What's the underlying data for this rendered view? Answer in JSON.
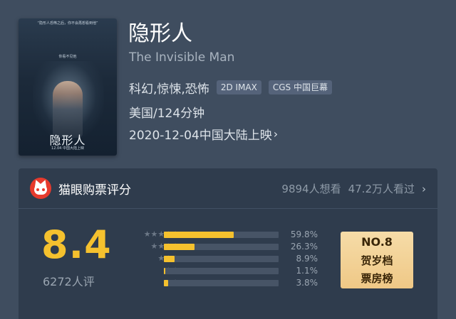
{
  "movie": {
    "poster": {
      "top_text": "“隐形人恐怖之后，你不会再想看到他”",
      "tagline": "你看不见他",
      "title": "隐形人",
      "date": "12.04 中国大陆上映"
    },
    "title_cn": "隐形人",
    "title_en": "The Invisible Man",
    "genres": "科幻,惊悚,恐怖",
    "badges": [
      "2D IMAX",
      "CGS 中国巨幕"
    ],
    "country_duration": "美国/124分钟",
    "release": "2020-12-04中国大陆上映",
    "release_chevron": "›"
  },
  "rating_panel": {
    "title": "猫眼购票评分",
    "want_to_see": "9894人想看",
    "watched": "47.2万人看过",
    "arrow": "›",
    "score": "8.4",
    "score_count": "6272人评",
    "distribution": [
      {
        "stars": "★★★★★",
        "percent_label": "59.8%",
        "fraction": 0.598
      },
      {
        "stars": "★★★★",
        "percent_label": "26.3%",
        "fraction": 0.263
      },
      {
        "stars": "★★★",
        "percent_label": "8.9%",
        "fraction": 0.089
      },
      {
        "stars": "★★",
        "percent_label": "1.1%",
        "fraction": 0.011
      },
      {
        "stars": "★",
        "percent_label": "3.8%",
        "fraction": 0.038
      }
    ],
    "rank": {
      "number": "NO.8",
      "line1": "贺岁档",
      "line2": "票房榜"
    }
  },
  "colors": {
    "background": "#3f4d5f",
    "panel": "#2f3c4d",
    "accent_yellow": "#f5c12e",
    "maoyan_red": "#e63a2d",
    "rank_gold": "#f2d296"
  }
}
